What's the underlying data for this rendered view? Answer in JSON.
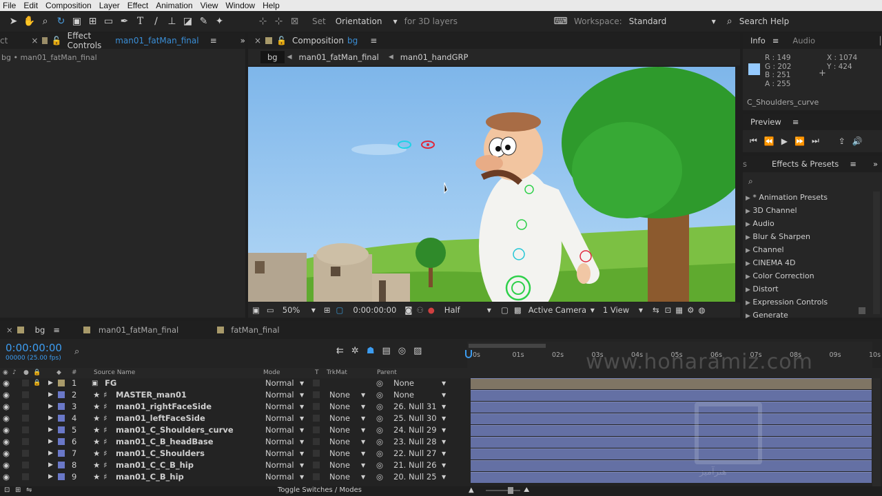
{
  "menu": [
    "File",
    "Edit",
    "Composition",
    "Layer",
    "Effect",
    "Animation",
    "View",
    "Window",
    "Help"
  ],
  "toolbar": {
    "set": "Set",
    "orientation": "Orientation",
    "for3d": "for 3D layers",
    "workspace_label": "Workspace:",
    "workspace_value": "Standard",
    "search": "Search Help"
  },
  "effect_panel": {
    "tab_title": "Effect Controls",
    "tab_layer": "man01_fatMan_final",
    "breadcrumb": "bg • man01_fatMan_final",
    "left_stub": "ct"
  },
  "comp_panel": {
    "tab_title": "Composition",
    "tab_comp": "bg",
    "crumbs": [
      "bg",
      "man01_fatMan_final",
      "man01_handGRP"
    ],
    "footer": {
      "zoom": "50%",
      "timecode": "0:00:00:00",
      "resolution": "Half",
      "camera": "Active Camera",
      "views": "1 View"
    }
  },
  "info": {
    "tab": "Info",
    "tab2": "Audio",
    "r": "R : 149",
    "g": "G : 202",
    "b": "B : 251",
    "a": "A : 255",
    "x": "X : 1074",
    "y": "Y : 424",
    "layer": "C_Shoulders_curve",
    "swatch_color": "#95caff"
  },
  "preview": {
    "tab": "Preview"
  },
  "effects": {
    "left_stub": "s",
    "tab": "Effects & Presets",
    "items": [
      "* Animation Presets",
      "3D Channel",
      "Audio",
      "Blur & Sharpen",
      "Channel",
      "CINEMA 4D",
      "Color Correction",
      "Distort",
      "Expression Controls",
      "Generate"
    ]
  },
  "timeline": {
    "tabs": [
      "bg",
      "man01_fatMan_final",
      "fatMan_final"
    ],
    "timecode": "0:00:00:00",
    "fps": "00000 (25.00 fps)",
    "headers": {
      "num": "#",
      "source": "Source Name",
      "mode": "Mode",
      "t": "T",
      "trkmat": "TrkMat",
      "parent": "Parent"
    },
    "ruler": [
      "0s",
      "01s",
      "02s",
      "03s",
      "04s",
      "05s",
      "06s",
      "07s",
      "08s",
      "09s",
      "10s"
    ],
    "layers": [
      {
        "num": "1",
        "name": "FG",
        "mode": "Normal",
        "trk": "",
        "parent": "None",
        "color": "#a89a6a",
        "locked": true
      },
      {
        "num": "2",
        "name": "MASTER_man01",
        "mode": "Normal",
        "trk": "None",
        "parent": "None",
        "color": "#6a78c8",
        "locked": false
      },
      {
        "num": "3",
        "name": "man01_rightFaceSide",
        "mode": "Normal",
        "trk": "None",
        "parent": "26. Null 31",
        "color": "#6a78c8",
        "locked": false
      },
      {
        "num": "4",
        "name": "man01_leftFaceSide",
        "mode": "Normal",
        "trk": "None",
        "parent": "25. Null 30",
        "color": "#6a78c8",
        "locked": false
      },
      {
        "num": "5",
        "name": "man01_C_Shoulders_curve",
        "mode": "Normal",
        "trk": "None",
        "parent": "24. Null 29",
        "color": "#6a78c8",
        "locked": false
      },
      {
        "num": "6",
        "name": "man01_C_B_headBase",
        "mode": "Normal",
        "trk": "None",
        "parent": "23. Null 28",
        "color": "#6a78c8",
        "locked": false
      },
      {
        "num": "7",
        "name": "man01_C_Shoulders",
        "mode": "Normal",
        "trk": "None",
        "parent": "22. Null 27",
        "color": "#6a78c8",
        "locked": false
      },
      {
        "num": "8",
        "name": "man01_C_C_B_hip",
        "mode": "Normal",
        "trk": "None",
        "parent": "21. Null 26",
        "color": "#6a78c8",
        "locked": false
      },
      {
        "num": "9",
        "name": "man01_C_B_hip",
        "mode": "Normal",
        "trk": "None",
        "parent": "20. Null 25",
        "color": "#6a78c8",
        "locked": false
      }
    ],
    "toggle": "Toggle Switches / Modes"
  },
  "watermark": "www.honaramiz.com",
  "watermark_fa": "هنرآمیز"
}
